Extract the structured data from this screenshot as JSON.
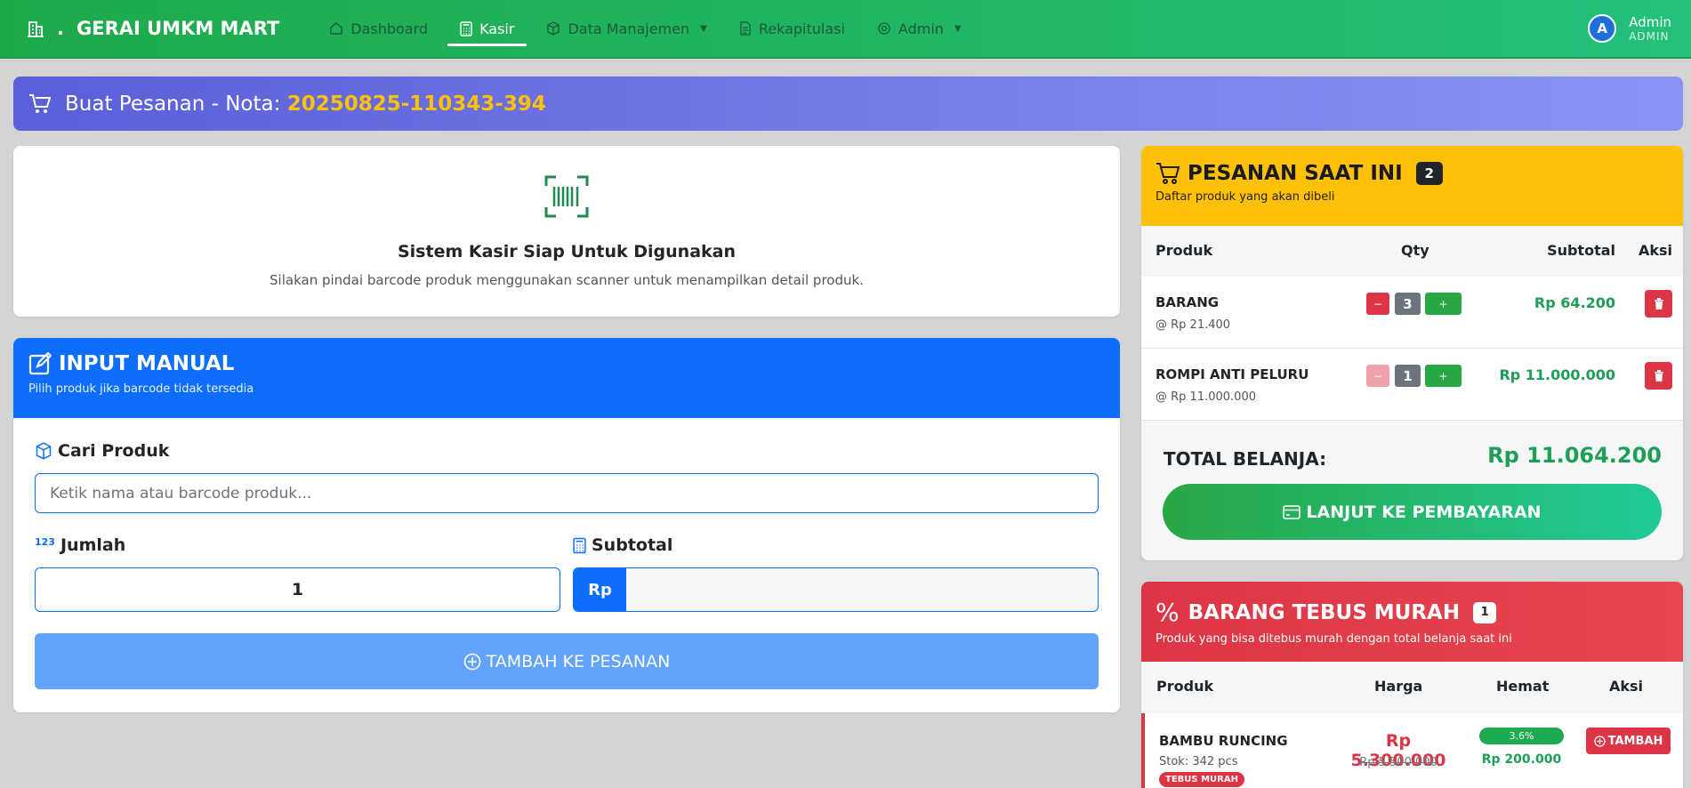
{
  "navbar": {
    "brand": "GERAI UMKM MART",
    "brand_dot": ".",
    "items": [
      {
        "label": "Dashboard",
        "icon": "home-icon"
      },
      {
        "label": "Kasir",
        "icon": "calculator-icon"
      },
      {
        "label": "Data Manajemen",
        "icon": "box-icon"
      },
      {
        "label": "Rekapitulasi",
        "icon": "document-icon"
      },
      {
        "label": "Admin",
        "icon": "gear-icon"
      }
    ],
    "user": {
      "initial": "A",
      "name": "Admin",
      "role": "ADMIN"
    }
  },
  "order": {
    "title_prefix": "Buat Pesanan - Nota: ",
    "nota": "20250825-110343-394"
  },
  "scan": {
    "title": "Sistem Kasir Siap Untuk Digunakan",
    "subtitle": "Silakan pindai barcode produk menggunakan scanner untuk menampilkan detail produk."
  },
  "manual": {
    "title": "INPUT MANUAL",
    "subtitle": "Pilih produk jika barcode tidak tersedia",
    "search_label": "Cari Produk",
    "search_placeholder": "Ketik nama atau barcode produk...",
    "qty_label": "Jumlah",
    "qty_icon_text": "123",
    "qty_value": "1",
    "subtotal_label": "Subtotal",
    "currency": "Rp",
    "add_button": "TAMBAH KE PESANAN"
  },
  "cart": {
    "title": "PESANAN SAAT INI",
    "count": "2",
    "subtitle": "Daftar produk yang akan dibeli",
    "headers": {
      "product": "Produk",
      "qty": "Qty",
      "subtotal": "Subtotal",
      "action": "Aksi"
    },
    "items": [
      {
        "name": "BARANG",
        "price": "@ Rp 21.400",
        "qty": "3",
        "subtotal": "Rp 64.200"
      },
      {
        "name": "ROMPI ANTI PELURU",
        "price": "@ Rp 11.000.000",
        "qty": "1",
        "subtotal": "Rp 11.000.000"
      }
    ],
    "minus": "−",
    "plus": "+",
    "total_label": "TOTAL BELANJA:",
    "total_value": "Rp 11.064.200",
    "pay_button": "LANJUT KE PEMBAYARAN"
  },
  "tebus": {
    "title": "BARANG TEBUS MURAH",
    "count": "1",
    "subtitle": "Produk yang bisa ditebus murah dengan total belanja saat ini",
    "headers": {
      "product": "Produk",
      "price": "Harga",
      "save": "Hemat",
      "action": "Aksi"
    },
    "item": {
      "name": "BAMBU RUNCING",
      "stock": "Stok: 342 pcs",
      "badge": "TEBUS MURAH",
      "price": "Rp 5.300.000",
      "old_price": "Rp 5.500.000",
      "save_pct": "3.6%",
      "save_value": "Rp 200.000",
      "button": "TAMBAH"
    }
  }
}
